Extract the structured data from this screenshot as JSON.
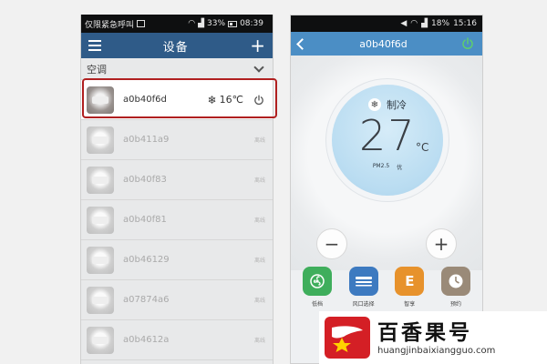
{
  "left_phone": {
    "status_bar": {
      "carrier": "仅限紧急呼叫",
      "battery": "33%",
      "time": "08:39"
    },
    "header": {
      "title": "设备"
    },
    "section": {
      "title": "空调"
    },
    "devices": [
      {
        "name": "a0b40f6d",
        "temp": "16℃",
        "status": ""
      },
      {
        "name": "a0b411a9",
        "temp": "",
        "status": "离线"
      },
      {
        "name": "a0b40f83",
        "temp": "",
        "status": "离线"
      },
      {
        "name": "a0b40f81",
        "temp": "",
        "status": "离线"
      },
      {
        "name": "a0b46129",
        "temp": "",
        "status": "离线"
      },
      {
        "name": "a07874a6",
        "temp": "",
        "status": "离线"
      },
      {
        "name": "a0b4612a",
        "temp": "",
        "status": "离线"
      }
    ]
  },
  "right_phone": {
    "status_bar": {
      "battery": "18%",
      "time": "15:16"
    },
    "header": {
      "title": "a0b40f6d"
    },
    "mode": "制冷",
    "temperature": "27",
    "unit": "°C",
    "pm_label": "PM2.5",
    "pm_value": "优",
    "features": [
      {
        "label": "低档"
      },
      {
        "label": "风口选择"
      },
      {
        "label": "智享",
        "glyph": "E"
      },
      {
        "label": "预约"
      }
    ]
  },
  "watermark": {
    "title": "百香果号",
    "url": "huangjinbaixiangguo.com"
  },
  "colors": {
    "left_header": "#2f5b88",
    "right_header": "#4b8ec5",
    "highlight": "#b02020",
    "power_green": "#5fd06a"
  }
}
